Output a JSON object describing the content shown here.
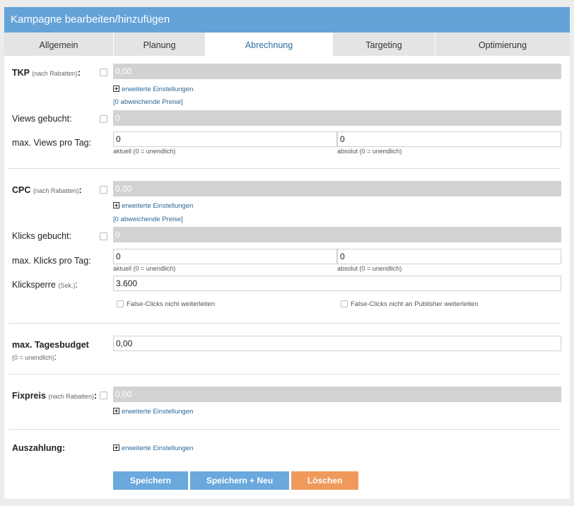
{
  "window": {
    "title": "Kampagne bearbeiten/hinzufügen"
  },
  "tabs": [
    "Allgemein",
    "Planung",
    "Abrechnung",
    "Targeting",
    "Optimierung"
  ],
  "active_tab": "Abrechnung",
  "tkp": {
    "label": "TKP",
    "sub": "(nach Rabatten)",
    "colon": ":",
    "value": "0,00",
    "link": "erweiterte Einstellungen",
    "prices": "[0 abweichende Preise]"
  },
  "views_gebucht": {
    "label": "Views gebucht:",
    "value": "0"
  },
  "max_views": {
    "label": "max. Views pro Tag:",
    "aktuell_value": "0",
    "aktuell_hint": "aktuell (0 = unendlich)",
    "absolut_value": "0",
    "absolut_hint": "absolut (0 = unendlich)"
  },
  "cpc": {
    "label": "CPC",
    "sub": "(nach Rabatten)",
    "colon": ":",
    "value": "0,00",
    "link": "erweiterte Einstellungen",
    "prices": "[0 abweichende Preise]"
  },
  "klicks_gebucht": {
    "label": "Klicks gebucht:",
    "value": "0"
  },
  "max_klicks": {
    "label": "max. Klicks pro Tag:",
    "aktuell_value": "0",
    "aktuell_hint": "aktuell (0 = unendlich)",
    "absolut_value": "0",
    "absolut_hint": "absolut (0 = unendlich)"
  },
  "klicksperre": {
    "label": "Klicksperre",
    "sub": "(Sek.)",
    "colon": ":",
    "value": "3.600",
    "opt1": "False-Clicks nicht weiterleiten",
    "opt2": "False-Clicks nicht an Publisher weiterleiten"
  },
  "tagesbudget": {
    "label": "max. Tagesbudget",
    "sub": "(0 = unendlich)",
    "colon": ":",
    "value": "0,00"
  },
  "fixpreis": {
    "label": "Fixpreis",
    "sub": "(nach Rabatten)",
    "colon": ":",
    "value": "0,00",
    "link": "erweiterte Einstellungen"
  },
  "auszahlung": {
    "label": "Auszahlung:",
    "link": "erweiterte Einstellungen"
  },
  "buttons": {
    "save": "Speichern",
    "save_new": "Speichern + Neu",
    "delete": "Löschen"
  },
  "colors": {
    "header": "#64a2d8",
    "button": "#6aa8dd",
    "delete": "#ef9a5c",
    "link": "#2b6797"
  }
}
